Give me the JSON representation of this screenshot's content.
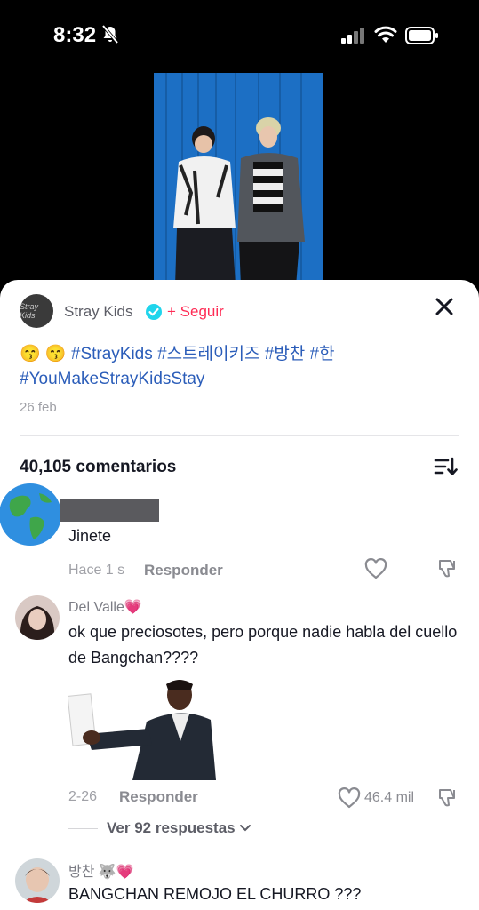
{
  "status_bar": {
    "time": "8:32"
  },
  "post": {
    "author": "Stray Kids",
    "avatar_text": "Stray Kids",
    "follow_label": "+ Seguir",
    "caption_emoji": "😙 😙",
    "caption_tags": "#StrayKids #스트레이키즈 #방찬 #한 #YouMakeStrayKidsStay",
    "date": "26 feb"
  },
  "comments_header": {
    "count_label": "40,105 comentarios"
  },
  "comments": [
    {
      "username": "",
      "text": "Jinete",
      "date": "Hace 1 s",
      "reply_label": "Responder"
    },
    {
      "username": "Del Valle💗",
      "text": "ok que preciosotes, pero porque nadie habla del cuello de Bangchan????",
      "date": "2-26",
      "reply_label": "Responder",
      "likes": "46.4 mil",
      "view_replies": "Ver 92 respuestas"
    },
    {
      "username": "방찬 🐺💗",
      "text": "BANGCHAN REMOJO EL CHURRO ???"
    }
  ],
  "colors": {
    "accent": "#fe2c55",
    "hashtag": "#2b5db9",
    "verified": "#20d5ec"
  }
}
